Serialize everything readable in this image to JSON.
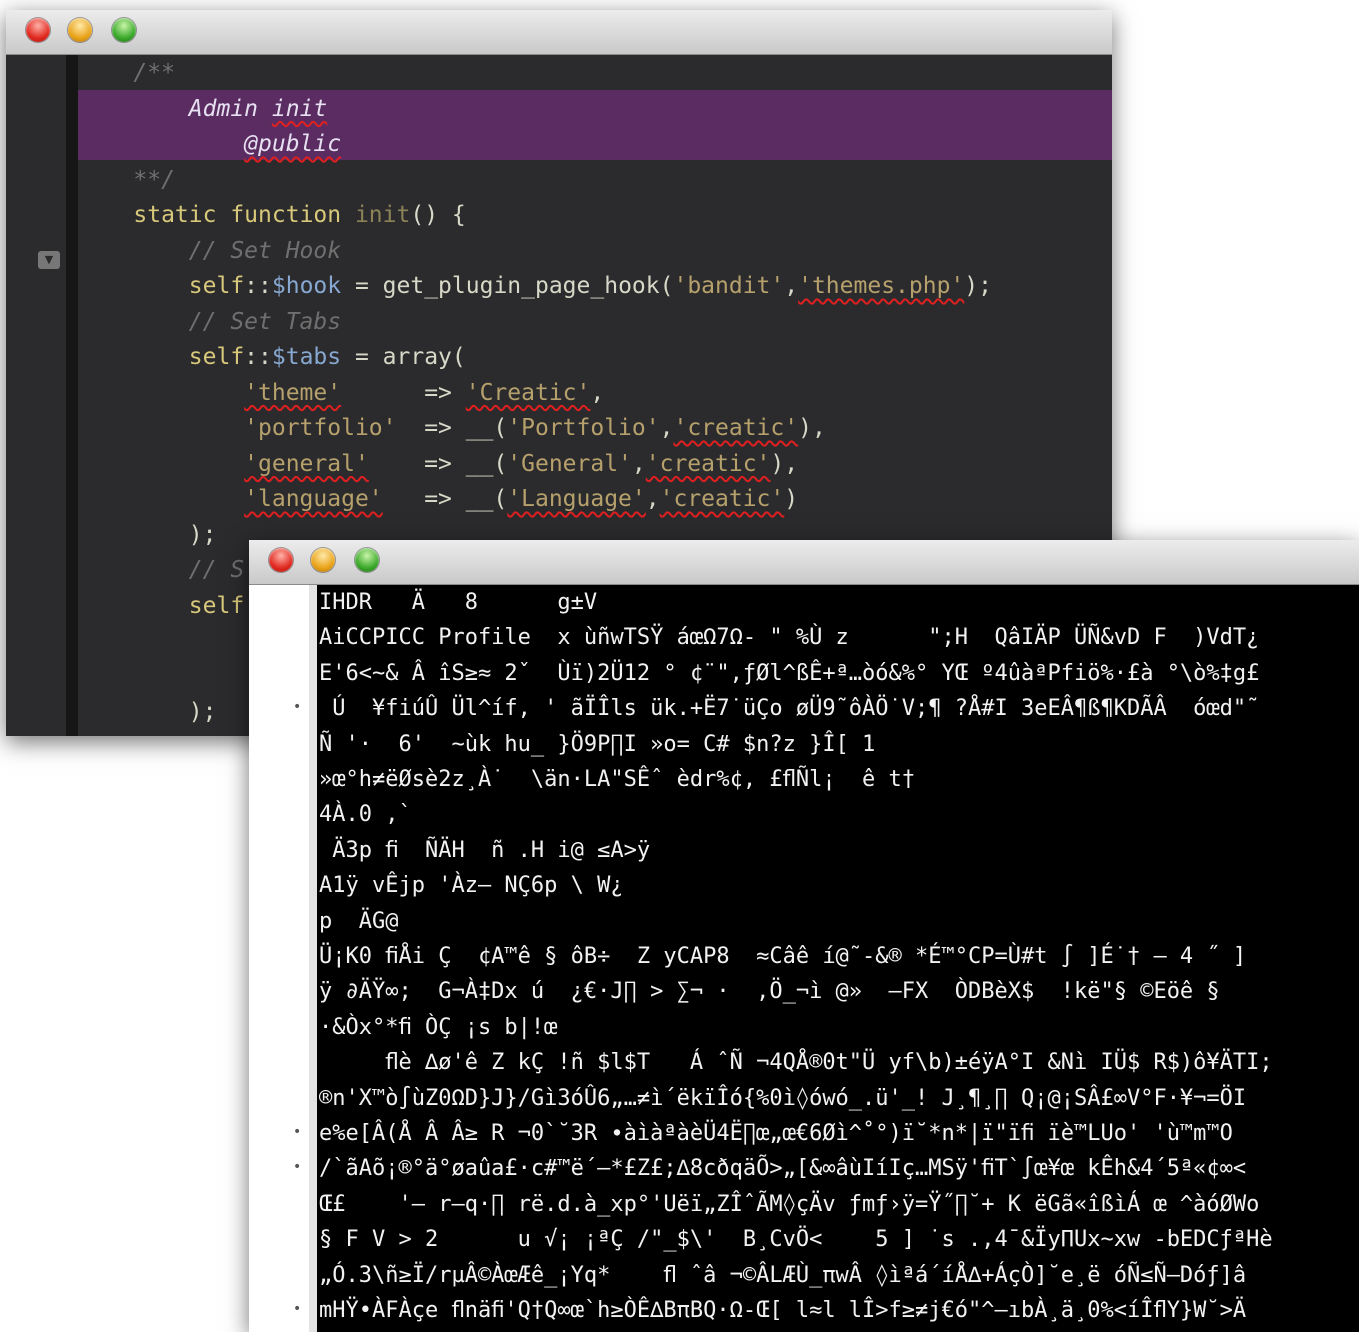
{
  "back_window": {
    "lines": [
      {
        "indent": "    ",
        "parts": [
          {
            "t": "/**",
            "c": "cm"
          }
        ]
      },
      {
        "indent": "        ",
        "parts": [
          {
            "t": "Admin ",
            "c": "cmh"
          },
          {
            "t": "init",
            "c": "cmh",
            "sq": true
          }
        ]
      },
      {
        "indent": "            ",
        "parts": [
          {
            "t": "@public",
            "c": "cmh",
            "sq": true
          }
        ]
      },
      {
        "indent": "    ",
        "parts": [
          {
            "t": "**/",
            "c": "cm"
          }
        ]
      },
      {
        "indent": "    ",
        "parts": [
          {
            "t": "static ",
            "c": "kw"
          },
          {
            "t": "function ",
            "c": "kw"
          },
          {
            "t": "init",
            "c": "fn"
          },
          {
            "t": "() {",
            "c": "op"
          }
        ]
      },
      {
        "indent": "        ",
        "parts": [
          {
            "t": "// Set Hook",
            "c": "cm"
          }
        ]
      },
      {
        "indent": "        ",
        "parts": [
          {
            "t": "self",
            "c": "kw"
          },
          {
            "t": "::",
            "c": "op"
          },
          {
            "t": "$hook",
            "c": "var"
          },
          {
            "t": " = get_plugin_page_hook(",
            "c": "op"
          },
          {
            "t": "'bandit'",
            "c": "str"
          },
          {
            "t": ",",
            "c": "op"
          },
          {
            "t": "'themes.php'",
            "c": "str",
            "sq": true
          },
          {
            "t": ");",
            "c": "op"
          }
        ]
      },
      {
        "indent": "        ",
        "parts": [
          {
            "t": "// Set Tabs",
            "c": "cm"
          }
        ]
      },
      {
        "indent": "        ",
        "parts": [
          {
            "t": "self",
            "c": "kw"
          },
          {
            "t": "::",
            "c": "op"
          },
          {
            "t": "$tabs",
            "c": "var"
          },
          {
            "t": " = array(",
            "c": "op"
          }
        ]
      },
      {
        "indent": "            ",
        "parts": [
          {
            "t": "'theme'",
            "c": "str",
            "sq": true
          },
          {
            "t": "      => ",
            "c": "op"
          },
          {
            "t": "'Creatic'",
            "c": "str",
            "sq": true
          },
          {
            "t": ",",
            "c": "op"
          }
        ]
      },
      {
        "indent": "            ",
        "parts": [
          {
            "t": "'portfolio'",
            "c": "str"
          },
          {
            "t": "  => __(",
            "c": "op"
          },
          {
            "t": "'Portfolio'",
            "c": "str"
          },
          {
            "t": ",",
            "c": "op"
          },
          {
            "t": "'creatic'",
            "c": "str",
            "sq": true
          },
          {
            "t": "),",
            "c": "op"
          }
        ]
      },
      {
        "indent": "            ",
        "parts": [
          {
            "t": "'general'",
            "c": "str",
            "sq": true
          },
          {
            "t": "    => __(",
            "c": "op"
          },
          {
            "t": "'General'",
            "c": "str"
          },
          {
            "t": ",",
            "c": "op"
          },
          {
            "t": "'creatic'",
            "c": "str",
            "sq": true
          },
          {
            "t": "),",
            "c": "op"
          }
        ]
      },
      {
        "indent": "            ",
        "parts": [
          {
            "t": "'language'",
            "c": "str",
            "sq": true
          },
          {
            "t": "   => __(",
            "c": "op"
          },
          {
            "t": "'Language'",
            "c": "str",
            "sq": true
          },
          {
            "t": ",",
            "c": "op"
          },
          {
            "t": "'creatic'",
            "c": "str",
            "sq": true
          },
          {
            "t": ")",
            "c": "op"
          }
        ]
      },
      {
        "indent": "        ",
        "parts": [
          {
            "t": ");",
            "c": "op"
          }
        ]
      },
      {
        "indent": "        ",
        "parts": [
          {
            "t": "// S",
            "c": "cm"
          }
        ]
      },
      {
        "indent": "        ",
        "parts": [
          {
            "t": "self",
            "c": "kw"
          }
        ]
      },
      {
        "indent": "",
        "parts": []
      },
      {
        "indent": "",
        "parts": []
      },
      {
        "indent": "        ",
        "parts": [
          {
            "t": ");",
            "c": "op"
          }
        ]
      }
    ]
  },
  "front_window": {
    "lines": [
      "IHDR   Ä   8      g±V",
      "AiCCPICC Profile  x ùñwTSŸ áœΩ7Ω- \" %Ù z      \";H  QâIÄP ÜÑ&vD F  )VdT¿",
      "E'6<~& Â îS≥≈ 2ˇ  Ùï)2Ü12 ° ¢¨\",ƒØl^ßÊ+ª…òó&%° YŒ º4ûàªPfiö%·£à °\\ò%‡g£",
      " Ú  ¥fiúÛ Ül^íf, ' ãÏÎls ük.+Ë7˙üÇo øÜ9˜ôÀÖ˙V;¶ ?Å#I 3eEÂ¶ß¶KDÃÂ  óœd\"˜",
      "Ñ '·  6'  ~ùk hu_ }Ö9P∏I »o= C# $n?z }Î[ 1",
      "»œ°h≠ëØsè2z¸À˙  \\än·LA\"SÊˆ èdr%¢, £ﬂÑl¡  ê t†",
      "4À.0 ,`",
      " Ä3p ﬁ  ÑÄH  ñ .H i@ ≤A>ÿ",
      "A1ÿ vÊjp 'Àz– NÇ6p \\ W¿",
      "p  ÄG@",
      "Ü¡K0 ﬁÅi Ç  ¢A™ê § ôB÷  Z yCAP8  ≈Câê í@˜-&® *É™°CP=Ù#t ∫ ]É˙† – 4 ˝ ]",
      "ÿ ∂ÄŸ∞;  G¬À‡Dx ú  ¿€·J∏ > ∑¬ ·  ,Ö_¬ì @»  –FX  ÒDBèX$  !kë\"§ ©Eöê §",
      "·&Òx°*ﬁ ÒÇ ¡s b|!œ",
      "     ﬂè ∆ø'ê Z kÇ !ñ $l$T   Á ˆÑ ¬4QÅ®0t\"Ü yf\\b)±éÿA°I &Nì IÜ$ R$)ô¥ÄTI;",
      "®n'X™ò∫ùZ0ΩD}J}/Gì3óÛ6„…≠ì´ëkïÎó{%0ì◊ówó_.ü'_! J¸¶¸∏ Q¡@¡SÂ£∞V°F·¥¬=ÖI",
      "e%e[Â(Å Â Â≥ R ¬0`˘3R ∙àìàªàèÜ4Ë∏œ„œ€6Øì^˚°)ï˘*n*|ï\"ïﬁ ïè™LUo' 'ù™m™O",
      "/`ãAõ¡®°ä°øaûa£·c#™ë´–*£Z£;∆8cðqäÕ>„[&∞âùIíIç…MSÿ'ﬁT`∫œ¥œ kÊh&4´5ª«¢∞<",
      "Œ£    '– r–q·∏ rë.d.à_xp°'Uëï„ZÎˆÃM◊çÄv ƒmƒ›ÿ=Ÿ˝∏˘+ K ëGã«îßìÁ œ ^àóØWo",
      "§ F V > 2      u √¡ ¡ªÇ /\"_$\\'  B¸CvÖ<    5 ] ˙s .,4¯&ÏyΠUx~xw -bEDCƒªHè",
      "„Ó.3\\ñ≥Ï/rµÂ©ÀœÆê_¡Yq*    ﬂ ˆâ ¬©ÂLÆÙ_πwÂ ◊ìªá´íÅ∆+ÁçÒ]˘e¸ë óÑ≤Ñ–Dóƒ]â",
      "mHŸ•ÀFÀçe ﬂnäﬁ'Q†Q∞œ`h≥ÒÊ∆BπBQ·Ω-Œ[ l≈l lÎ>f≥≠j€ó\"^–ıbÀ¸ä¸0%<íÎﬂY}W˘>Ä"
    ],
    "dots": [
      3,
      15,
      16,
      20
    ]
  }
}
